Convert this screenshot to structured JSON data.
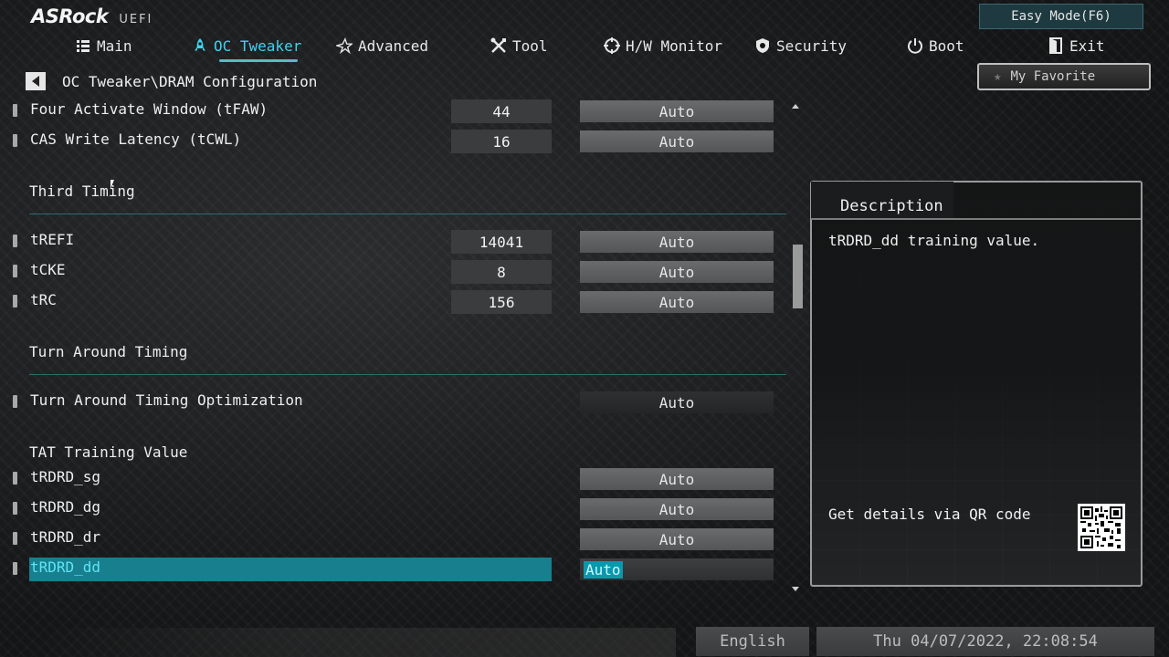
{
  "header": {
    "logo_main": "ASRock",
    "logo_sub": "UEFI",
    "easy_mode_label": "Easy Mode(F6)"
  },
  "nav": {
    "items": [
      {
        "label": "Main",
        "icon": "list-icon"
      },
      {
        "label": "OC Tweaker",
        "icon": "rocket-icon",
        "active": true
      },
      {
        "label": "Advanced",
        "icon": "star-icon"
      },
      {
        "label": "Tool",
        "icon": "tools-icon"
      },
      {
        "label": "H/W Monitor",
        "icon": "crosshair-icon"
      },
      {
        "label": "Security",
        "icon": "shield-icon"
      },
      {
        "label": "Boot",
        "icon": "power-icon"
      },
      {
        "label": "Exit",
        "icon": "exit-icon"
      }
    ]
  },
  "breadcrumb": "OC Tweaker\\DRAM Configuration",
  "favorite_label": "My Favorite",
  "rows": {
    "tfaw": {
      "label": "Four Activate Window (tFAW)",
      "value": "44",
      "option": "Auto"
    },
    "tcwl": {
      "label": "CAS Write Latency (tCWL)",
      "value": "16",
      "option": "Auto"
    },
    "trefi": {
      "label": "tREFI",
      "value": "14041",
      "option": "Auto"
    },
    "tcke": {
      "label": "tCKE",
      "value": "8",
      "option": "Auto"
    },
    "trc": {
      "label": "tRC",
      "value": "156",
      "option": "Auto"
    },
    "tat_opt": {
      "label": "Turn Around Timing Optimization",
      "option": "Auto"
    },
    "trdrd_sg": {
      "label": "tRDRD_sg",
      "option": "Auto"
    },
    "trdrd_dg": {
      "label": "tRDRD_dg",
      "option": "Auto"
    },
    "trdrd_dr": {
      "label": "tRDRD_dr",
      "option": "Auto"
    },
    "trdrd_dd": {
      "label": "tRDRD_dd",
      "option": "Auto",
      "selected": true
    }
  },
  "sections": {
    "third_timing": "Third Timing",
    "turn_around": "Turn Around Timing",
    "tat_training": "TAT Training Value"
  },
  "description": {
    "title": "Description",
    "text": "tRDRD_dd training value.",
    "qr_text": "Get details via QR code"
  },
  "footer": {
    "language": "English",
    "datetime": "Thu 04/07/2022, 22:08:54"
  },
  "colors": {
    "accent": "#3fd2ee",
    "selection": "#177f8e",
    "divider": "#2f6a73"
  }
}
